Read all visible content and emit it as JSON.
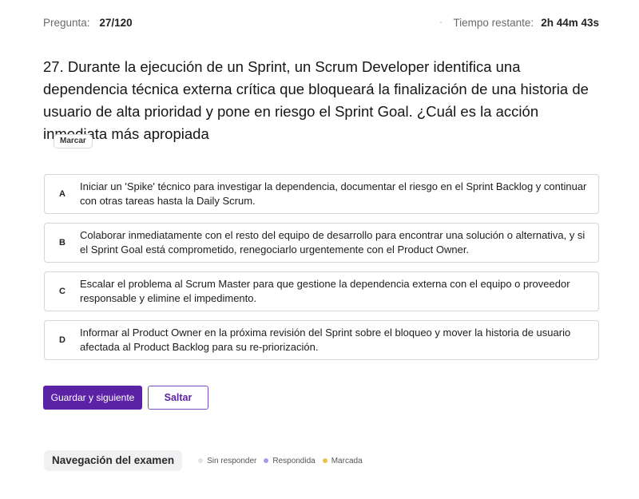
{
  "header": {
    "question_label": "Pregunta:",
    "question_progress": "27/120",
    "time_label": "Tiempo restante:",
    "time_value": "2h 44m 43s"
  },
  "question": {
    "text": "27. Durante la ejecución de un Sprint, un Scrum Developer identifica una dependencia técnica externa crítica que bloqueará la finalización de una historia de usuario de alta prioridad y pone en riesgo el Sprint Goal. ¿Cuál es la acción inmediata más apropiada",
    "mark_label": "Marcar"
  },
  "options": [
    {
      "letter": "A",
      "text": "Iniciar un 'Spike' técnico para investigar la dependencia, documentar el riesgo en el Sprint Backlog y continuar con otras tareas hasta la Daily Scrum."
    },
    {
      "letter": "B",
      "text": "Colaborar inmediatamente con el resto del equipo de desarrollo para encontrar una solución o alternativa, y si el Sprint Goal está comprometido, renegociarlo urgentemente con el Product Owner."
    },
    {
      "letter": "C",
      "text": "Escalar el problema al Scrum Master para que gestione la dependencia externa con el equipo o proveedor responsable y elimine el impedimento."
    },
    {
      "letter": "D",
      "text": "Informar al Product Owner en la próxima revisión del Sprint sobre el bloqueo y mover la historia de usuario afectada al Product Backlog para su re-priorización."
    }
  ],
  "actions": {
    "save_next_label": "Guardar y siguiente",
    "skip_label": "Saltar"
  },
  "navigation": {
    "title": "Navegación del examen",
    "legend": [
      {
        "label": "Sin responder",
        "color": "#e3e3e6"
      },
      {
        "label": "Respondida",
        "color": "#a99ae6"
      },
      {
        "label": "Marcada",
        "color": "#e9c24a"
      }
    ]
  },
  "colors": {
    "accent": "#5b22a6"
  }
}
